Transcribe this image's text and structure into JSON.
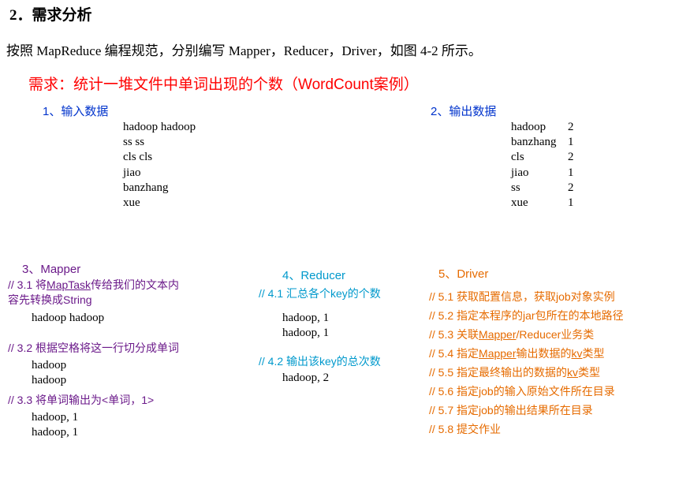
{
  "heading": "2．需求分析",
  "intro": "按照 MapReduce 编程规范，分别编写 Mapper，Reducer，Driver，如图 4-2 所示。",
  "req_title": "需求：统计一堆文件中单词出现的个数（WordCount案例）",
  "input": {
    "label": "1、输入数据",
    "lines": [
      "hadoop hadoop",
      "ss ss",
      "cls cls",
      "jiao",
      "banzhang",
      "xue"
    ]
  },
  "output": {
    "label": "2、输出数据",
    "rows": [
      {
        "k": "hadoop",
        "v": "2"
      },
      {
        "k": "banzhang",
        "v": "1"
      },
      {
        "k": "cls",
        "v": "2"
      },
      {
        "k": "jiao",
        "v": "1"
      },
      {
        "k": "ss",
        "v": "2"
      },
      {
        "k": "xue",
        "v": "1"
      }
    ]
  },
  "mapper": {
    "label": "3、Mapper",
    "s1_a": "// 3.1 将",
    "s1_u": "MapTask",
    "s1_b": "传给我们的文本内容先转换成String",
    "d1": "hadoop hadoop",
    "s2": "// 3.2 根据空格将这一行切分成单词",
    "d2a": "hadoop",
    "d2b": "hadoop",
    "s3": "// 3.3 将单词输出为<单词，1>",
    "d3a": "hadoop, 1",
    "d3b": "hadoop, 1"
  },
  "reducer": {
    "label": "4、Reducer",
    "s1": "// 4.1 汇总各个key的个数",
    "d1a": "hadoop, 1",
    "d1b": "hadoop, 1",
    "s2": "// 4.2  输出该key的总次数",
    "d2": "hadoop, 2"
  },
  "driver": {
    "label": "5、Driver",
    "l1": "// 5.1 获取配置信息，获取job对象实例",
    "l2": "// 5.2 指定本程序的jar包所在的本地路径",
    "l3_a": "// 5.3 关联",
    "l3_u1": "Mapper",
    "l3_b": "/Reducer业务类",
    "l4_a": "// 5.4 指定",
    "l4_u1": "Mapper",
    "l4_b": "输出数据的",
    "l4_u2": "kv",
    "l4_c": "类型",
    "l5_a": "// 5.5 指定最终输出的数据的",
    "l5_u": "kv",
    "l5_b": "类型",
    "l6": "// 5.6 指定job的输入原始文件所在目录",
    "l7": "// 5.7 指定job的输出结果所在目录",
    "l8": "// 5.8 提交作业"
  }
}
